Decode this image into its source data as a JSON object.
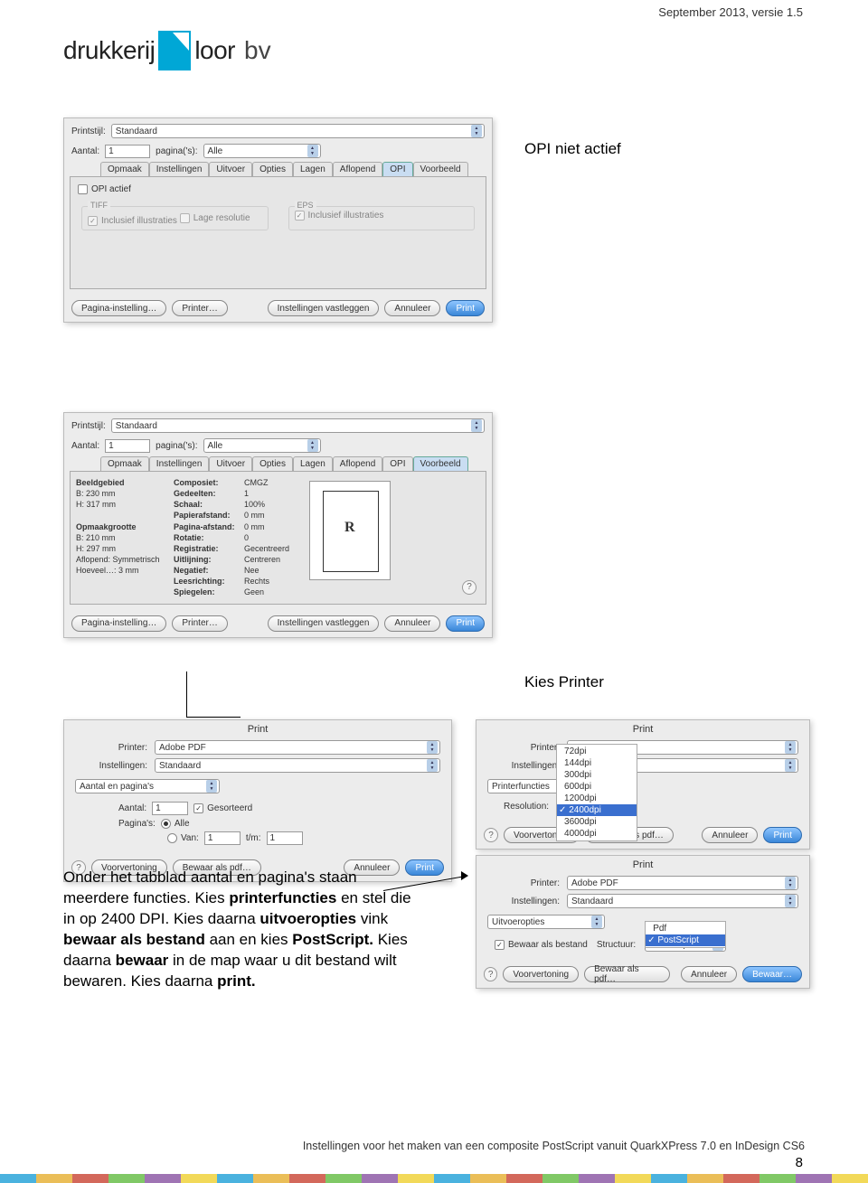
{
  "header": {
    "date": "September 2013, versie 1.5"
  },
  "logo": {
    "part1": "drukkerij",
    "part2": "loor",
    "part3": "bv"
  },
  "captions": {
    "d1": "OPI niet actief",
    "d2": "Kies Printer"
  },
  "common": {
    "printstijl_label": "Printstijl:",
    "printstijl_value": "Standaard",
    "aantal_label": "Aantal:",
    "aantal_value": "1",
    "paginas_label": "pagina('s):",
    "paginas_value": "Alle",
    "tabs": [
      "Opmaak",
      "Instellingen",
      "Uitvoer",
      "Opties",
      "Lagen",
      "Aflopend",
      "OPI",
      "Voorbeeld"
    ],
    "buttons": {
      "pagina_instelling": "Pagina-instelling…",
      "printer": "Printer…",
      "instellingen_vastleggen": "Instellingen vastleggen",
      "annuleer": "Annuleer",
      "print": "Print",
      "voorvertoning": "Voorvertoning",
      "bewaar_als_pdf": "Bewaar als pdf…",
      "bewaar": "Bewaar…"
    }
  },
  "d1": {
    "active_tab": "OPI",
    "opi_actief": "OPI actief",
    "tiff": "TIFF",
    "eps": "EPS",
    "inclusief_illustraties": "Inclusief illustraties",
    "lage_resolutie": "Lage resolutie"
  },
  "d2": {
    "active_tab": "Voorbeeld",
    "left": {
      "beeldgebied": "Beeldgebied",
      "b1": "B: 230 mm",
      "h1": "H: 317 mm",
      "opmaakgrootte": "Opmaakgrootte",
      "b2": "B: 210 mm",
      "h2": "H: 297 mm",
      "aflopend": "Aflopend: Symmetrisch",
      "hoeveel": "Hoeveel…: 3 mm"
    },
    "mid_labels": [
      "Composiet:",
      "Gedeelten:",
      "Schaal:",
      "Papierafstand:",
      "Pagina-afstand:",
      "Rotatie:",
      "Registratie:",
      "Uitlijning:",
      "Negatief:",
      "Leesrichting:",
      "Spiegelen:"
    ],
    "mid_values": [
      "CMGZ",
      "1",
      "100%",
      "0 mm",
      "0 mm",
      "0",
      "Gecentreerd",
      "Centreren",
      "Nee",
      "Rechts",
      "Geen"
    ]
  },
  "d3": {
    "title": "Print",
    "printer_label": "Printer:",
    "printer_value": "Adobe PDF",
    "instellingen_label": "Instellingen:",
    "instellingen_value": "Standaard",
    "tab": "Aantal en pagina's",
    "aantal_label": "Aantal:",
    "aantal_value": "1",
    "gesorteerd": "Gesorteerd",
    "paginas_label": "Pagina's:",
    "alle": "Alle",
    "van": "Van:",
    "van_value": "1",
    "tm": "t/m:",
    "tm_value": "1"
  },
  "d4": {
    "title": "Print",
    "printer_label": "Printer:",
    "instellingen_label": "Instellingen:",
    "printerfuncties": "Printerfuncties",
    "resolution_label": "Resolution:",
    "dpi_options": [
      "72dpi",
      "144dpi",
      "300dpi",
      "600dpi",
      "1200dpi",
      "2400dpi",
      "3600dpi",
      "4000dpi"
    ],
    "dpi_selected": "2400dpi"
  },
  "d5": {
    "title": "Print",
    "printer_label": "Printer:",
    "printer_value": "Adobe PDF",
    "instellingen_label": "Instellingen:",
    "instellingen_value": "Standaard",
    "uitvoeropties": "Uitvoeropties",
    "bewaar_als_bestand": "Bewaar als bestand",
    "structuur_label": "Structuur:",
    "pdf": "Pdf",
    "postscript": "PostScript"
  },
  "body": {
    "p1": "Onder het tabblad aantal en pagina's staan meerdere functies.",
    "p2a": "Kies ",
    "p2b": "printerfuncties",
    "p2c": " en stel die in op 2400 DPI.",
    "p3a": "Kies daarna ",
    "p3b": "uitvoeropties",
    "p3c": " vink ",
    "p3d": "bewaar als bestand",
    "p3e": " aan en kies ",
    "p3f": "PostScript.",
    "p4a": " Kies daarna ",
    "p4b": "bewaar",
    "p4c": " in de map waar u dit bestand wilt bewaren. Kies daarna ",
    "p4d": "print."
  },
  "footer": {
    "text": "Instellingen voor het maken van een composite PostScript vanuit QuarkXPress 7.0 en InDesign CS6",
    "page": "8"
  }
}
